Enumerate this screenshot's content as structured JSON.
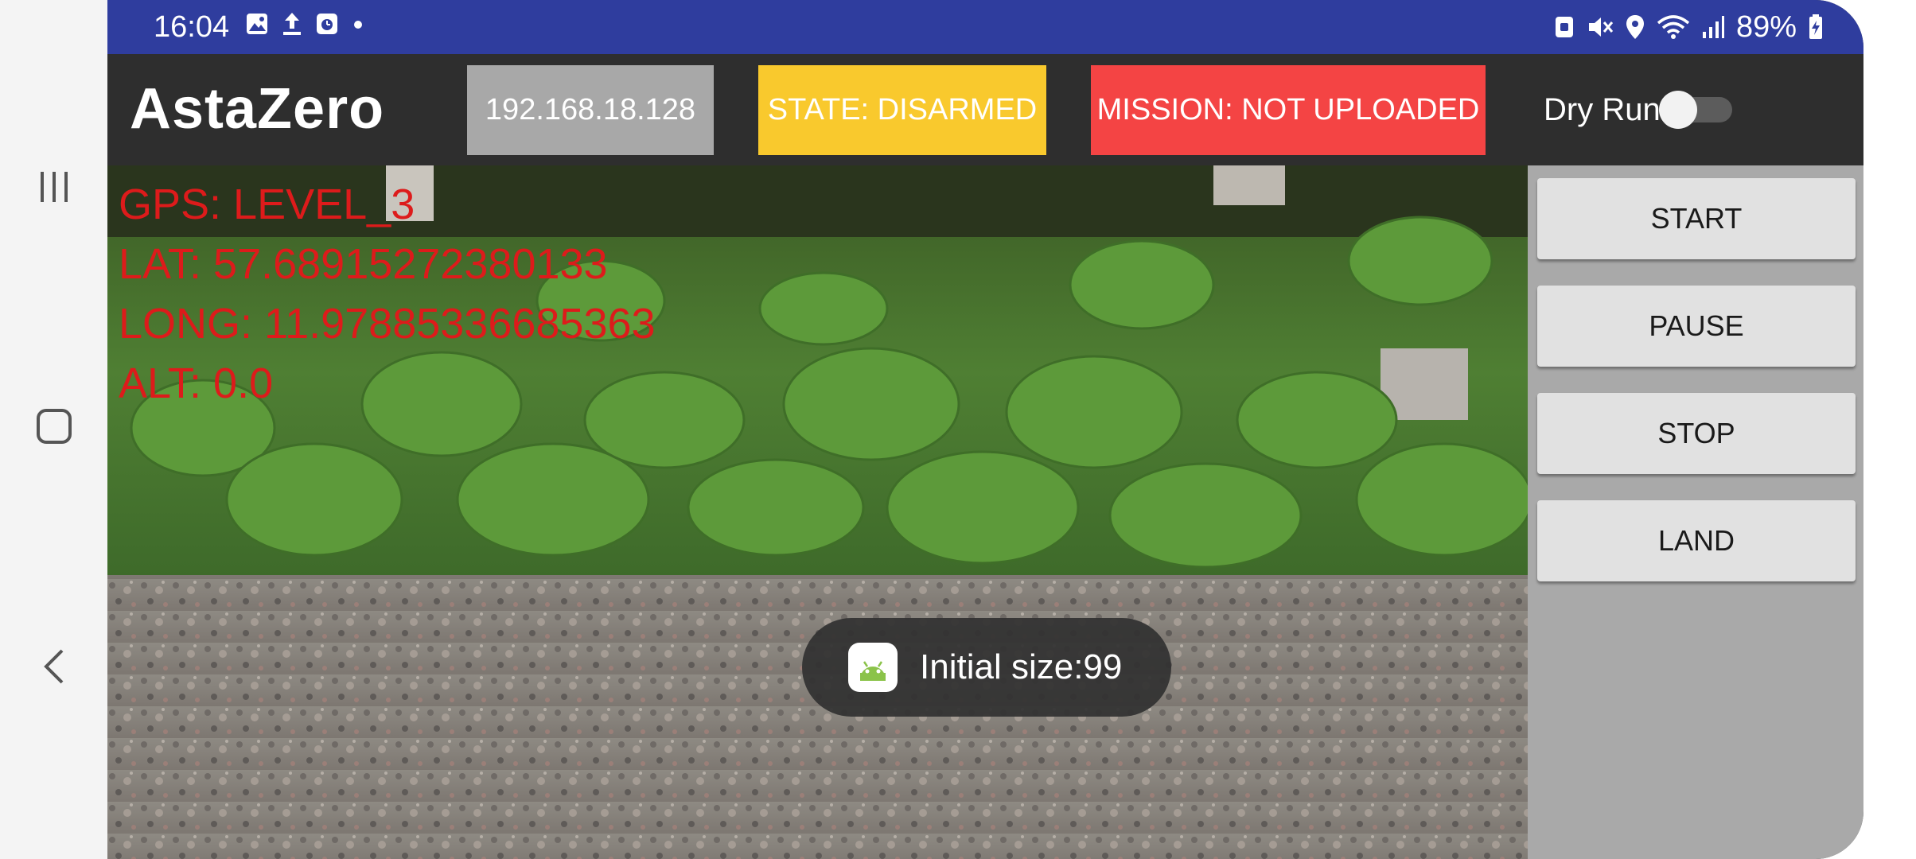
{
  "status_bar": {
    "time": "16:04",
    "battery": "89%",
    "left_icons": [
      "gallery-icon",
      "upload-icon",
      "clock-app-icon",
      "dot-icon"
    ],
    "right_icons": [
      "nfc-icon",
      "mute-icon",
      "location-icon",
      "wifi-icon",
      "signal-icon",
      "battery-charging-icon"
    ]
  },
  "app_bar": {
    "logo": "AstaZero",
    "ip_address": "192.168.18.128",
    "state": "STATE: DISARMED",
    "mission": "MISSION: NOT UPLOADED",
    "dry_run_label": "Dry Run",
    "dry_run_enabled": false
  },
  "telemetry": {
    "gps": "GPS: LEVEL_3",
    "lat": "LAT: 57.68915272380133",
    "long": "LONG: 11.97885336685363",
    "alt": "ALT: 0.0"
  },
  "controls": {
    "start": "START",
    "pause": "PAUSE",
    "stop": "STOP",
    "land": "LAND"
  },
  "toast": {
    "text": "Initial size:99",
    "icon": "android-icon"
  },
  "nav_bar": {
    "icons": [
      "recent-apps-icon",
      "home-icon",
      "back-icon"
    ]
  },
  "colors": {
    "status_bar": "#2f3d9e",
    "app_bar": "#2e2e2e",
    "ip_chip": "#a8a8a8",
    "state_chip": "#f9c92d",
    "mission_chip": "#f44444",
    "telemetry_text": "#dd1b1b",
    "side_panel": "#a9a9a9",
    "button": "#e1e1e1"
  }
}
